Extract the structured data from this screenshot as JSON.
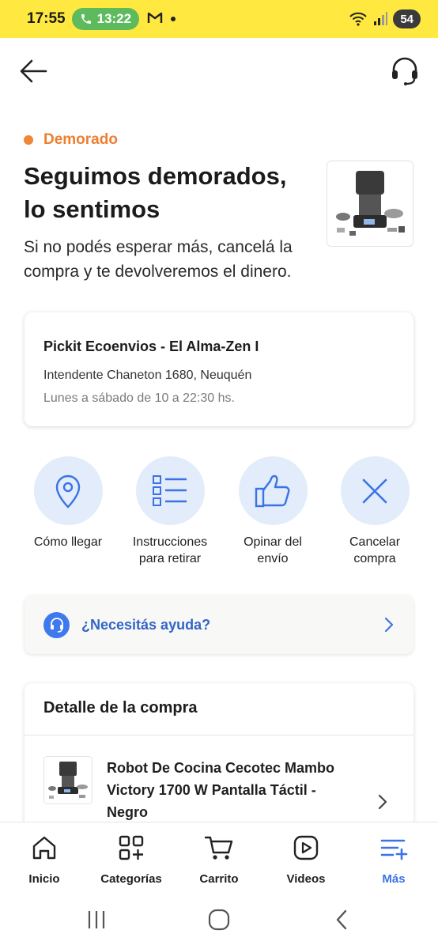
{
  "status_bar": {
    "time": "17:55",
    "call_timer": "13:22",
    "mail_icon": "gmail-icon",
    "battery": "54",
    "accent_color": "#ffe83f"
  },
  "header": {
    "back_icon": "arrow-left-icon",
    "support_icon": "headset-icon"
  },
  "order_status": {
    "label": "Demorado",
    "color": "#f0863a",
    "headline": "Seguimos demorados, lo sentimos",
    "message": "Si no podés esperar más, cancelá la compra y te devolveremos el dinero."
  },
  "pickup": {
    "name": "Pickit Ecoenvios - El Alma-Zen I",
    "address": "Intendente Chaneton 1680, Neuquén",
    "hours": "Lunes a sábado de 10 a 22:30 hs."
  },
  "actions": [
    {
      "label_line1": "Cómo llegar",
      "label_line2": "",
      "icon": "location-pin-icon"
    },
    {
      "label_line1": "Instrucciones",
      "label_line2": "para retirar",
      "icon": "list-icon"
    },
    {
      "label_line1": "Opinar del",
      "label_line2": "envío",
      "icon": "thumbs-up-icon"
    },
    {
      "label_line1": "Cancelar",
      "label_line2": "compra",
      "icon": "close-icon"
    }
  ],
  "help": {
    "label": "¿Necesitás ayuda?",
    "icon": "headset-icon"
  },
  "purchase_detail": {
    "title": "Detalle de la compra",
    "item_title": "Robot De Cocina Cecotec Mambo Victory 1700 W Pantalla Táctil - Negro"
  },
  "bottom_nav": [
    {
      "label": "Inicio",
      "icon": "home-icon",
      "active": false
    },
    {
      "label": "Categorías",
      "icon": "categories-icon",
      "active": false
    },
    {
      "label": "Carrito",
      "icon": "cart-icon",
      "active": false
    },
    {
      "label": "Videos",
      "icon": "play-icon",
      "active": false
    },
    {
      "label": "Más",
      "icon": "menu-plus-icon",
      "active": true
    }
  ],
  "active_color": "#3b73e6"
}
